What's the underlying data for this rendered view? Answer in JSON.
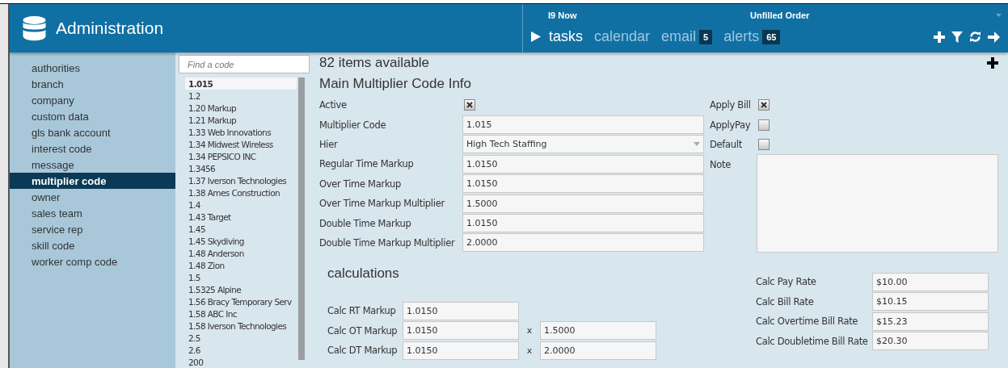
{
  "header": {
    "title": "Administration",
    "notifications": [
      "I9 Now",
      "Unfilled Order"
    ],
    "nav": [
      {
        "label": "tasks",
        "selected": true
      },
      {
        "label": "calendar",
        "selected": false
      },
      {
        "label": "email",
        "badge": "5",
        "selected": false
      },
      {
        "label": "alerts",
        "badge": "65",
        "selected": false
      }
    ]
  },
  "sidebar": {
    "items": [
      {
        "label": "authorities",
        "selected": false
      },
      {
        "label": "branch",
        "selected": false
      },
      {
        "label": "company",
        "selected": false
      },
      {
        "label": "custom data",
        "selected": false
      },
      {
        "label": "gls bank account",
        "selected": false
      },
      {
        "label": "interest code",
        "selected": false
      },
      {
        "label": "message",
        "selected": false
      },
      {
        "label": "multiplier code",
        "selected": true
      },
      {
        "label": "owner",
        "selected": false
      },
      {
        "label": "sales team",
        "selected": false
      },
      {
        "label": "service rep",
        "selected": false
      },
      {
        "label": "skill code",
        "selected": false
      },
      {
        "label": "worker comp code",
        "selected": false
      }
    ]
  },
  "code_list": {
    "search": {
      "placeholder": "Find a code"
    },
    "items": [
      {
        "label": "1.015",
        "selected": true
      },
      {
        "label": "1.2",
        "selected": false
      },
      {
        "label": "1.20 Markup",
        "selected": false
      },
      {
        "label": "1.21 Markup",
        "selected": false
      },
      {
        "label": "1.33 Web Innovations",
        "selected": false
      },
      {
        "label": "1.34 Midwest Wireless",
        "selected": false
      },
      {
        "label": "1.34 PEPSICO INC",
        "selected": false
      },
      {
        "label": "1.3456",
        "selected": false
      },
      {
        "label": "1.37 Iverson Technologies",
        "selected": false
      },
      {
        "label": "1.38 Ames Construction",
        "selected": false
      },
      {
        "label": "1.4",
        "selected": false
      },
      {
        "label": "1.43 Target",
        "selected": false
      },
      {
        "label": "1.45",
        "selected": false
      },
      {
        "label": "1.45 Skydiving",
        "selected": false
      },
      {
        "label": "1.48 Anderson",
        "selected": false
      },
      {
        "label": "1.48 Zion",
        "selected": false
      },
      {
        "label": "1.5",
        "selected": false
      },
      {
        "label": "1.5325 Alpine",
        "selected": false
      },
      {
        "label": "1.56 Bracy Temporary Serv",
        "selected": false
      },
      {
        "label": "1.58 ABC Inc",
        "selected": false
      },
      {
        "label": "1.58 Iverson Technologies",
        "selected": false
      },
      {
        "label": "2.5",
        "selected": false
      },
      {
        "label": "2.6",
        "selected": false
      },
      {
        "label": "200",
        "selected": false
      }
    ]
  },
  "main": {
    "count": "82 items available",
    "section_title": "Main Multiplier Code Info",
    "fields": [
      {
        "label": "Active",
        "kind": "checkbox",
        "checked": true
      },
      {
        "label": "Multiplier Code",
        "kind": "text",
        "value": "1.015"
      },
      {
        "label": "Hier",
        "kind": "select",
        "value": "High Tech Staffing"
      },
      {
        "label": "Regular Time Markup",
        "kind": "text",
        "value": "1.0150"
      },
      {
        "label": "Over Time Markup",
        "kind": "text",
        "value": "1.0150"
      },
      {
        "label": "Over Time Markup Multiplier",
        "kind": "text",
        "value": "1.5000"
      },
      {
        "label": "Double Time Markup",
        "kind": "text",
        "value": "1.0150"
      },
      {
        "label": "Double Time Markup Multiplier",
        "kind": "text",
        "value": "2.0000"
      }
    ],
    "side_fields": [
      {
        "label": "Apply Bill",
        "kind": "checkbox",
        "checked": true
      },
      {
        "label": "ApplyPay",
        "kind": "checkbox",
        "checked": false
      },
      {
        "label": "Default",
        "kind": "checkbox",
        "checked": false
      },
      {
        "label": "Note",
        "kind": "textarea"
      }
    ]
  },
  "calculations": {
    "title": "calculations",
    "markups": [
      {
        "label": "Calc RT Markup",
        "value": "1.0150"
      },
      {
        "label": "Calc OT Markup",
        "value": "1.0150",
        "operator": "x",
        "multiplier": "1.5000"
      },
      {
        "label": "Calc DT Markup",
        "value": "1.0150",
        "operator": "x",
        "multiplier": "2.0000"
      }
    ],
    "rates": [
      {
        "label": "Calc Pay Rate",
        "value": "$10.00"
      },
      {
        "label": "Calc Bill Rate",
        "value": "$10.15"
      },
      {
        "label": "Calc Overtime Bill Rate",
        "value": "$15.23"
      },
      {
        "label": "Calc Doubletime Bill Rate",
        "value": "$20.30"
      }
    ]
  }
}
